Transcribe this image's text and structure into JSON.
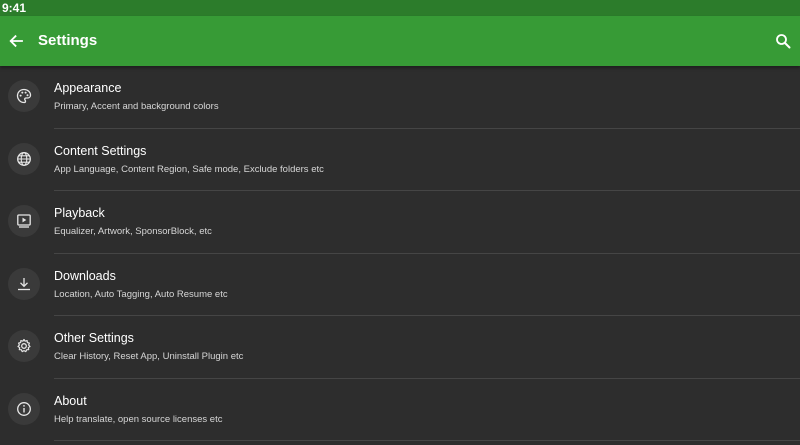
{
  "status_bar": {
    "time": "9:41"
  },
  "app_bar": {
    "title": "Settings",
    "back_icon": "arrow-back-icon",
    "search_icon": "search-icon",
    "color": "#379b36"
  },
  "settings": [
    {
      "icon": "palette-icon",
      "title": "Appearance",
      "subtitle": "Primary, Accent and background colors"
    },
    {
      "icon": "globe-icon",
      "title": "Content Settings",
      "subtitle": "App Language, Content Region, Safe mode, Exclude folders etc"
    },
    {
      "icon": "playback-icon",
      "title": "Playback",
      "subtitle": "Equalizer, Artwork, SponsorBlock, etc"
    },
    {
      "icon": "download-icon",
      "title": "Downloads",
      "subtitle": "Location, Auto Tagging, Auto Resume etc"
    },
    {
      "icon": "gear-icon",
      "title": "Other Settings",
      "subtitle": "Clear History, Reset App, Uninstall Plugin etc"
    },
    {
      "icon": "info-icon",
      "title": "About",
      "subtitle": "Help translate, open source licenses etc"
    }
  ]
}
